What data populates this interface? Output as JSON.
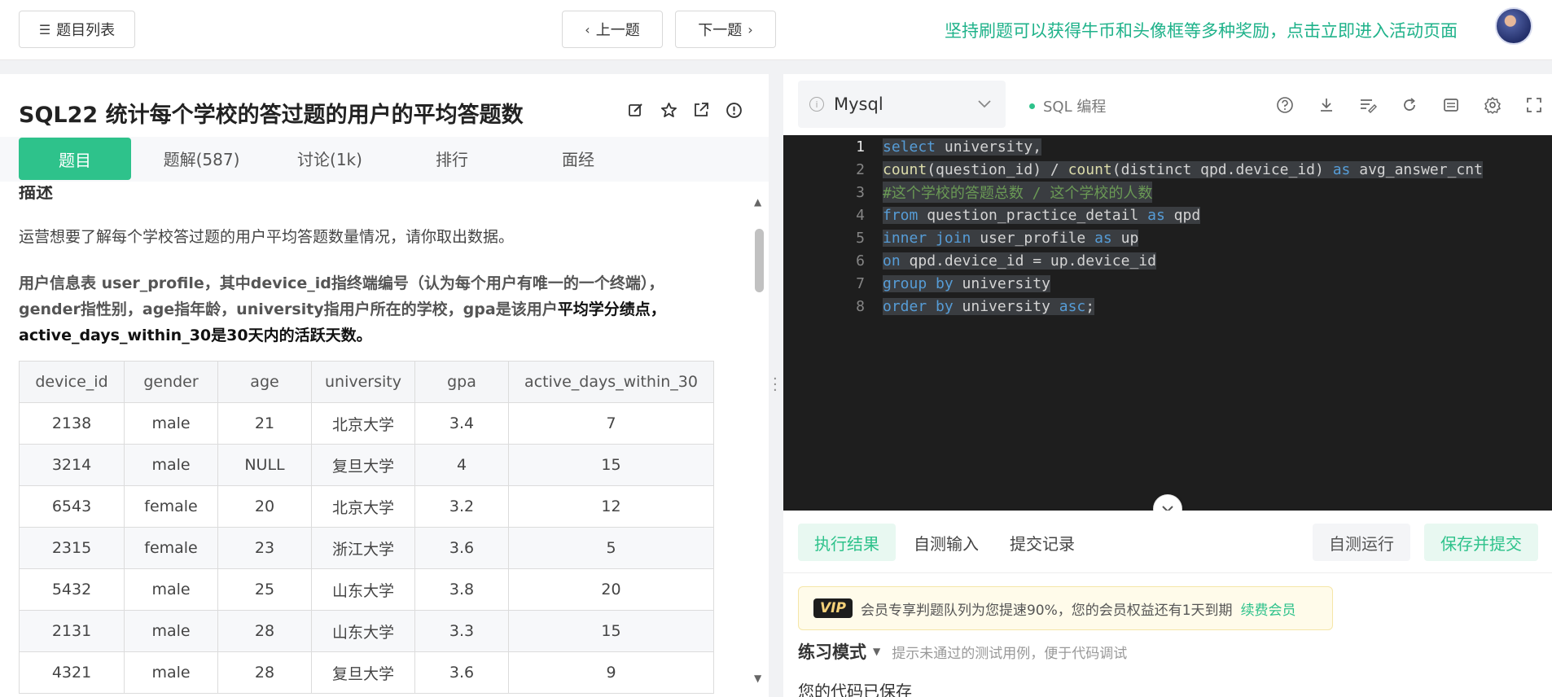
{
  "topbar": {
    "list_label": "题目列表",
    "prev_label": "上一题",
    "next_label": "下一题",
    "promo": "坚持刷题可以获得牛币和头像框等多种奖励，点击立即进入活动页面"
  },
  "question": {
    "title": "SQL22  统计每个学校的答过题的用户的平均答题数",
    "tabs": [
      "题目",
      "题解(587)",
      "讨论(1k)",
      "排行",
      "面经"
    ],
    "cut_heading": "描述",
    "desc1": "运营想要了解每个学校答过题的用户平均答题数量情况，请你取出数据。",
    "desc2_part1": "用户信息表 user_profile，其中device_id指终端编号（认为每个用户有唯一的一个终端），gender指性别，age指年龄，university指用户所在的学校，gpa是该用户",
    "desc2_part2": "平均学分绩点，active_days_within_30是30天内的活跃天数。",
    "table": {
      "headers": [
        "device_id",
        "gender",
        "age",
        "university",
        "gpa",
        "active_days_within_30"
      ],
      "rows": [
        [
          "2138",
          "male",
          "21",
          "北京大学",
          "3.4",
          "7"
        ],
        [
          "3214",
          "male",
          "NULL",
          "复旦大学",
          "4",
          "15"
        ],
        [
          "6543",
          "female",
          "20",
          "北京大学",
          "3.2",
          "12"
        ],
        [
          "2315",
          "female",
          "23",
          "浙江大学",
          "3.6",
          "5"
        ],
        [
          "5432",
          "male",
          "25",
          "山东大学",
          "3.8",
          "20"
        ],
        [
          "2131",
          "male",
          "28",
          "山东大学",
          "3.3",
          "15"
        ],
        [
          "4321",
          "male",
          "28",
          "复旦大学",
          "3.6",
          "9"
        ]
      ]
    }
  },
  "editor": {
    "language": "Mysql",
    "mode": "SQL 编程",
    "line_numbers": [
      "1",
      "2",
      "3",
      "4",
      "5",
      "6",
      "7",
      "8"
    ],
    "code": [
      "select university,",
      "count(question_id) / count(distinct qpd.device_id) as avg_answer_cnt",
      "#这个学校的答题总数 / 这个学校的人数",
      "from question_practice_detail as qpd",
      "inner join user_profile as up",
      "on qpd.device_id = up.device_id",
      "group by university",
      "order by university asc;"
    ]
  },
  "results": {
    "tabs": [
      "执行结果",
      "自测输入",
      "提交记录"
    ],
    "selftest_label": "自测运行",
    "submit_label": "保存并提交",
    "vip_badge": "VIP",
    "vip_text": "会员专享判题队列为您提速90%，您的会员权益还有1天到期",
    "vip_link": "续费会员",
    "practice_mode": "练习模式",
    "practice_hint": "提示未通过的测试用例，便于代码调试",
    "saved_text": "您的代码已保存"
  },
  "colors": {
    "accent": "#2ec28b",
    "editor_bg": "#1e1e1e"
  }
}
